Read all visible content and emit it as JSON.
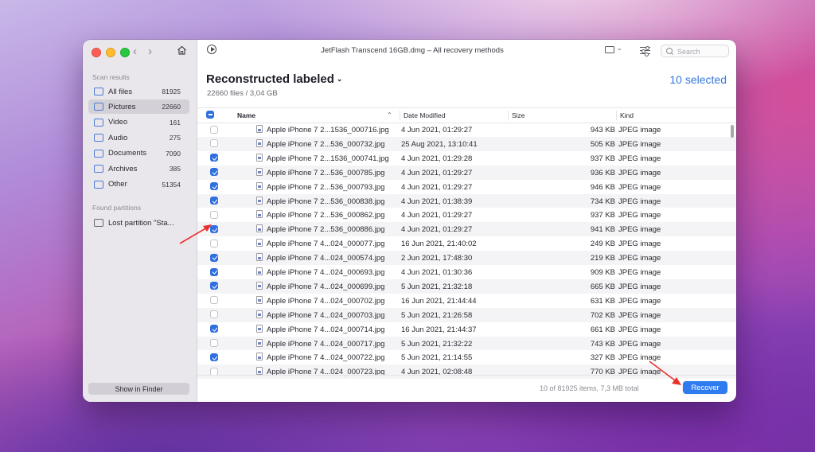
{
  "window": {
    "title": "JetFlash Transcend 16GB.dmg – All recovery methods"
  },
  "sidebar": {
    "scan_results_label": "Scan results",
    "items": [
      {
        "label": "All files",
        "count": "81925",
        "icon": "files-icon"
      },
      {
        "label": "Pictures",
        "count": "22660",
        "icon": "pictures-icon",
        "selected": true
      },
      {
        "label": "Video",
        "count": "161",
        "icon": "video-icon"
      },
      {
        "label": "Audio",
        "count": "275",
        "icon": "audio-icon"
      },
      {
        "label": "Documents",
        "count": "7090",
        "icon": "documents-icon"
      },
      {
        "label": "Archives",
        "count": "385",
        "icon": "archives-icon"
      },
      {
        "label": "Other",
        "count": "51354",
        "icon": "other-icon"
      }
    ],
    "found_partitions_label": "Found partitions",
    "partition_label": "Lost partition \"Sta...",
    "show_in_finder": "Show in Finder"
  },
  "toolbar": {
    "search_placeholder": "Search"
  },
  "header": {
    "title": "Reconstructed labeled",
    "subtitle": "22660 files / 3,04 GB",
    "selected": "10 selected"
  },
  "table": {
    "columns": {
      "name": "Name",
      "date": "Date Modified",
      "size": "Size",
      "kind": "Kind"
    },
    "rows": [
      {
        "checked": false,
        "name": "Apple iPhone 7 2...1536_000716.jpg",
        "date": "4 Jun 2021, 01:29:27",
        "size": "943 KB",
        "kind": "JPEG image"
      },
      {
        "checked": false,
        "name": "Apple iPhone 7 2...536_000732.jpg",
        "date": "25 Aug 2021, 13:10:41",
        "size": "505 KB",
        "kind": "JPEG image"
      },
      {
        "checked": true,
        "name": "Apple iPhone 7 2...1536_000741.jpg",
        "date": "4 Jun 2021, 01:29:28",
        "size": "937 KB",
        "kind": "JPEG image"
      },
      {
        "checked": true,
        "name": "Apple iPhone 7 2...536_000785.jpg",
        "date": "4 Jun 2021, 01:29:27",
        "size": "936 KB",
        "kind": "JPEG image"
      },
      {
        "checked": true,
        "name": "Apple iPhone 7 2...536_000793.jpg",
        "date": "4 Jun 2021, 01:29:27",
        "size": "946 KB",
        "kind": "JPEG image"
      },
      {
        "checked": true,
        "name": "Apple iPhone 7 2...536_000838.jpg",
        "date": "4 Jun 2021, 01:38:39",
        "size": "734 KB",
        "kind": "JPEG image"
      },
      {
        "checked": false,
        "name": "Apple iPhone 7 2...536_000862.jpg",
        "date": "4 Jun 2021, 01:29:27",
        "size": "937 KB",
        "kind": "JPEG image"
      },
      {
        "checked": true,
        "name": "Apple iPhone 7 2...536_000886.jpg",
        "date": "4 Jun 2021, 01:29:27",
        "size": "941 KB",
        "kind": "JPEG image"
      },
      {
        "checked": false,
        "name": "Apple iPhone 7 4...024_000077.jpg",
        "date": "16 Jun 2021, 21:40:02",
        "size": "249 KB",
        "kind": "JPEG image"
      },
      {
        "checked": true,
        "name": "Apple iPhone 7 4...024_000574.jpg",
        "date": "2 Jun 2021, 17:48:30",
        "size": "219 KB",
        "kind": "JPEG image"
      },
      {
        "checked": true,
        "name": "Apple iPhone 7 4...024_000693.jpg",
        "date": "4 Jun 2021, 01:30:36",
        "size": "909 KB",
        "kind": "JPEG image"
      },
      {
        "checked": true,
        "name": "Apple iPhone 7 4...024_000699.jpg",
        "date": "5 Jun 2021, 21:32:18",
        "size": "665 KB",
        "kind": "JPEG image"
      },
      {
        "checked": false,
        "name": "Apple iPhone 7 4...024_000702.jpg",
        "date": "16 Jun 2021, 21:44:44",
        "size": "631 KB",
        "kind": "JPEG image"
      },
      {
        "checked": false,
        "name": "Apple iPhone 7 4...024_000703.jpg",
        "date": "5 Jun 2021, 21:26:58",
        "size": "702 KB",
        "kind": "JPEG image"
      },
      {
        "checked": true,
        "name": "Apple iPhone 7 4...024_000714.jpg",
        "date": "16 Jun 2021, 21:44:37",
        "size": "661 KB",
        "kind": "JPEG image"
      },
      {
        "checked": false,
        "name": "Apple iPhone 7 4...024_000717.jpg",
        "date": "5 Jun 2021, 21:32:22",
        "size": "743 KB",
        "kind": "JPEG image"
      },
      {
        "checked": true,
        "name": "Apple iPhone 7 4...024_000722.jpg",
        "date": "5 Jun 2021, 21:14:55",
        "size": "327 KB",
        "kind": "JPEG image"
      },
      {
        "checked": false,
        "name": "Apple iPhone 7 4...024_000723.jpg",
        "date": "4 Jun 2021, 02:08:48",
        "size": "770 KB",
        "kind": "JPEG image"
      }
    ]
  },
  "footer": {
    "info": "10 of 81925 items, 7,3 MB total",
    "recover": "Recover"
  },
  "colors": {
    "accent": "#2f7cf0",
    "annotation_arrow": "#e8302c"
  }
}
